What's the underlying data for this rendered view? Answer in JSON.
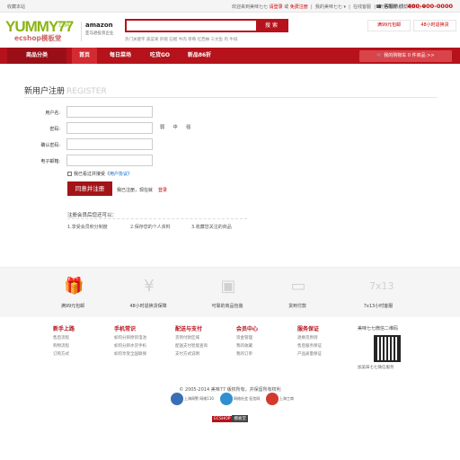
{
  "topbar": {
    "favorite": "收藏本站",
    "welcome": "欢迎来到美味七七",
    "login": "请登录",
    "or": "或",
    "register": "免费注册",
    "my_account": "我的美味七七 ▾",
    "orders": "在线客服",
    "points": "积分商城",
    "help": "帮助中心 ▾",
    "hotline_label": "客服热线:",
    "hotline": "400-000-0000"
  },
  "logo": {
    "main": "YUMMY77",
    "com": ".COM",
    "sub": "ecshop模板堂"
  },
  "amazon": {
    "name": "amazon",
    "tagline": "亚马逊投资企业"
  },
  "search": {
    "placeholder": "",
    "button": "搜 索"
  },
  "hotwords": "热门关键字  蔬菜果  肝猪  石榴  牛肉  草莓  红西柚  三文鱼  鸡  牛排",
  "promos": [
    {
      "label": "满99元包邮",
      "color": "#cc0000"
    },
    {
      "label": "48小时退换货",
      "color": "#cc0000"
    }
  ],
  "nav": {
    "category": "商品分类",
    "items": [
      "首页",
      "每日菜场",
      "吃货GO",
      "新品86折"
    ],
    "cart": "我的购物车 0 件商品  >>"
  },
  "page": {
    "title": "新用户注册",
    "title_en": "REGISTER"
  },
  "form": {
    "username_label": "用户名:",
    "password_label": "密码:",
    "confirm_label": "确认密码:",
    "email_label": "电子邮箱:",
    "strength": "弱 中 强",
    "agree_text": "我已看过并接受《",
    "agree_link": "用户协议",
    "agree_end": "》",
    "submit": "同意并注册",
    "already": "我已注册，现在就",
    "login": "登录"
  },
  "hints": {
    "title": "注册会员后您还可以：",
    "items": [
      "1.享受会员积分制度",
      "2.保存您的个人资料",
      "3.收藏您关注的商品"
    ]
  },
  "services": [
    {
      "icon": "gift-icon",
      "label": "满99元包邮"
    },
    {
      "icon": "yen-icon",
      "label": "48小时退换货保障"
    },
    {
      "icon": "package-icon",
      "label": "可靠的商品包装"
    },
    {
      "icon": "card-icon",
      "label": "货到付款"
    },
    {
      "icon": "clock-icon",
      "label": "7x13小时客服"
    }
  ],
  "help_cols": [
    {
      "title": "新手上路",
      "links": [
        "售后流程",
        "购物流程",
        "订购方式"
      ]
    },
    {
      "title": "手机常识",
      "links": [
        "如何分辨原装电池",
        "如何分辨水货手机",
        "如何享受全国联保"
      ]
    },
    {
      "title": "配送与支付",
      "links": [
        "货到付款区域",
        "配送支付智能查询",
        "支付方式说明"
      ]
    },
    {
      "title": "会员中心",
      "links": [
        "资金管理",
        "我的收藏",
        "我的订单"
      ]
    },
    {
      "title": "服务保证",
      "links": [
        "退换货原则",
        "售后服务保证",
        "产品质量保证"
      ]
    }
  ],
  "qr": {
    "title": "美味七七微信二维码",
    "bottom": "加美味七七微信服务"
  },
  "footer": {
    "copyright": "© 2005-2014 美味77 版权所有，并保留所有权利",
    "badges": [
      "上海网警 网络110",
      "网络社会 征信网",
      "上海工商"
    ],
    "logos": [
      "ECSHOP",
      "模板堂"
    ]
  }
}
